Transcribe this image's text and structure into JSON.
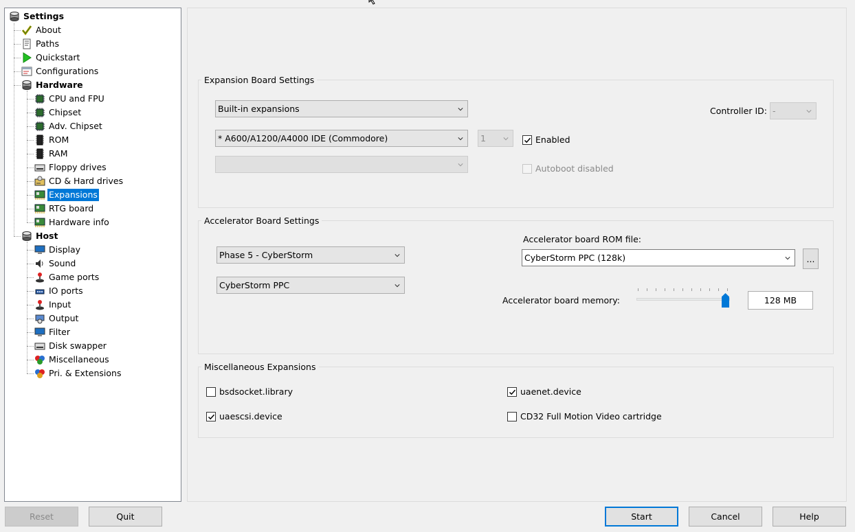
{
  "tree": {
    "items": [
      {
        "label": "Settings",
        "icon": "settings-icon",
        "level": 0,
        "bold": true
      },
      {
        "label": "About",
        "icon": "checkmark-icon",
        "level": 1
      },
      {
        "label": "Paths",
        "icon": "paths-icon",
        "level": 1
      },
      {
        "label": "Quickstart",
        "icon": "play-icon",
        "level": 1
      },
      {
        "label": "Configurations",
        "icon": "configurations-icon",
        "level": 1
      },
      {
        "label": "Hardware",
        "icon": "hardware-icon",
        "level": 1,
        "bold": true
      },
      {
        "label": "CPU and FPU",
        "icon": "chip-icon",
        "level": 2
      },
      {
        "label": "Chipset",
        "icon": "chip-icon",
        "level": 2
      },
      {
        "label": "Adv. Chipset",
        "icon": "chip-icon",
        "level": 2
      },
      {
        "label": "ROM",
        "icon": "rom-icon",
        "level": 2
      },
      {
        "label": "RAM",
        "icon": "ram-icon",
        "level": 2
      },
      {
        "label": "Floppy drives",
        "icon": "floppy-icon",
        "level": 2
      },
      {
        "label": "CD & Hard drives",
        "icon": "harddrive-icon",
        "level": 2
      },
      {
        "label": "Expansions",
        "icon": "expansion-card-icon",
        "level": 2,
        "selected": true
      },
      {
        "label": "RTG board",
        "icon": "expansion-card-icon",
        "level": 2
      },
      {
        "label": "Hardware info",
        "icon": "expansion-card-icon",
        "level": 2
      },
      {
        "label": "Host",
        "icon": "host-icon",
        "level": 1,
        "bold": true
      },
      {
        "label": "Display",
        "icon": "monitor-icon",
        "level": 2
      },
      {
        "label": "Sound",
        "icon": "sound-icon",
        "level": 2
      },
      {
        "label": "Game ports",
        "icon": "joystick-icon",
        "level": 2
      },
      {
        "label": "IO ports",
        "icon": "io-ports-icon",
        "level": 2
      },
      {
        "label": "Input",
        "icon": "joystick-icon",
        "level": 2
      },
      {
        "label": "Output",
        "icon": "output-icon",
        "level": 2
      },
      {
        "label": "Filter",
        "icon": "monitor-icon",
        "level": 2
      },
      {
        "label": "Disk swapper",
        "icon": "floppy-icon",
        "level": 2
      },
      {
        "label": "Miscellaneous",
        "icon": "misc-icon",
        "level": 2
      },
      {
        "label": "Pri. & Extensions",
        "icon": "extensions-icon",
        "level": 2
      }
    ]
  },
  "expansion": {
    "legend": "Expansion Board Settings",
    "category_value": "Built-in expansions",
    "board_value": "* A600/A1200/A4000 IDE (Commodore)",
    "unit_value": "1",
    "sub_value": "",
    "enabled_label": "Enabled",
    "enabled_checked": true,
    "autoboot_label": "Autoboot disabled",
    "autoboot_checked": false,
    "controller_label": "Controller ID:",
    "controller_value": "-"
  },
  "accelerator": {
    "legend": "Accelerator Board Settings",
    "board_value": "Phase 5 - CyberStorm",
    "model_value": "CyberStorm PPC",
    "rom_label": "Accelerator board ROM file:",
    "rom_value": "CyberStorm PPC (128k)",
    "browse_label": "...",
    "memory_label": "Accelerator board memory:",
    "memory_value": "128 MB",
    "memory_slider_fraction": 1.0
  },
  "misc": {
    "legend": "Miscellaneous Expansions",
    "items": [
      {
        "label": "bsdsocket.library",
        "checked": false
      },
      {
        "label": "uaenet.device",
        "checked": true
      },
      {
        "label": "uaescsi.device",
        "checked": true
      },
      {
        "label": "CD32 Full Motion Video cartridge",
        "checked": false
      }
    ]
  },
  "buttons": {
    "reset": "Reset",
    "quit": "Quit",
    "start": "Start",
    "cancel": "Cancel",
    "help": "Help"
  },
  "colors": {
    "accent": "#0078d7",
    "window_bg": "#f0f0f0"
  }
}
